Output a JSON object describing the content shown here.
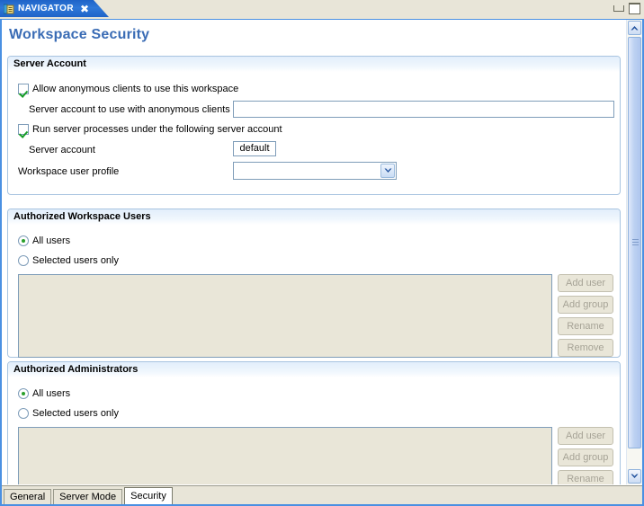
{
  "window": {
    "view_tab_label": "NAVIGATOR",
    "view_tab_icon": "navigator-icon",
    "close_icon": "close-icon",
    "minimize_icon": "minimize-icon",
    "maximize_icon": "maximize-icon",
    "accent_color": "#4a90e2",
    "title_color": "#3a6cb5"
  },
  "page": {
    "title": "Workspace Security"
  },
  "server_account": {
    "header": "Server Account",
    "allow_anonymous": {
      "label": "Allow anonymous clients to use this workspace",
      "checked": true
    },
    "anonymous_account": {
      "label": "Server account to use with anonymous clients",
      "value": "",
      "placeholder": ""
    },
    "run_under_account": {
      "label": "Run server processes under the following server account",
      "checked": true
    },
    "server_account": {
      "label": "Server account",
      "value": "default"
    },
    "user_profile": {
      "label": "Workspace user profile",
      "value": "",
      "options": [
        ""
      ]
    }
  },
  "authorized_users": {
    "header": "Authorized Workspace Users",
    "all_users_label": "All users",
    "selected_users_label": "Selected users only",
    "selection": "all",
    "list_items": [],
    "buttons": [
      {
        "label": "Add user",
        "enabled": false
      },
      {
        "label": "Add group",
        "enabled": false
      },
      {
        "label": "Rename",
        "enabled": false
      },
      {
        "label": "Remove",
        "enabled": false
      }
    ]
  },
  "authorized_admins": {
    "header": "Authorized Administrators",
    "all_users_label": "All users",
    "selected_users_label": "Selected users only",
    "selection": "all",
    "list_items": [],
    "buttons": [
      {
        "label": "Add user",
        "enabled": false
      },
      {
        "label": "Add group",
        "enabled": false
      },
      {
        "label": "Rename",
        "enabled": false
      }
    ]
  },
  "bottom_tabs": {
    "items": [
      {
        "label": "General",
        "active": false
      },
      {
        "label": "Server Mode",
        "active": false
      },
      {
        "label": "Security",
        "active": true
      }
    ]
  },
  "scrollbar": {
    "up_icon": "chevron-up-icon",
    "down_icon": "chevron-down-icon"
  }
}
